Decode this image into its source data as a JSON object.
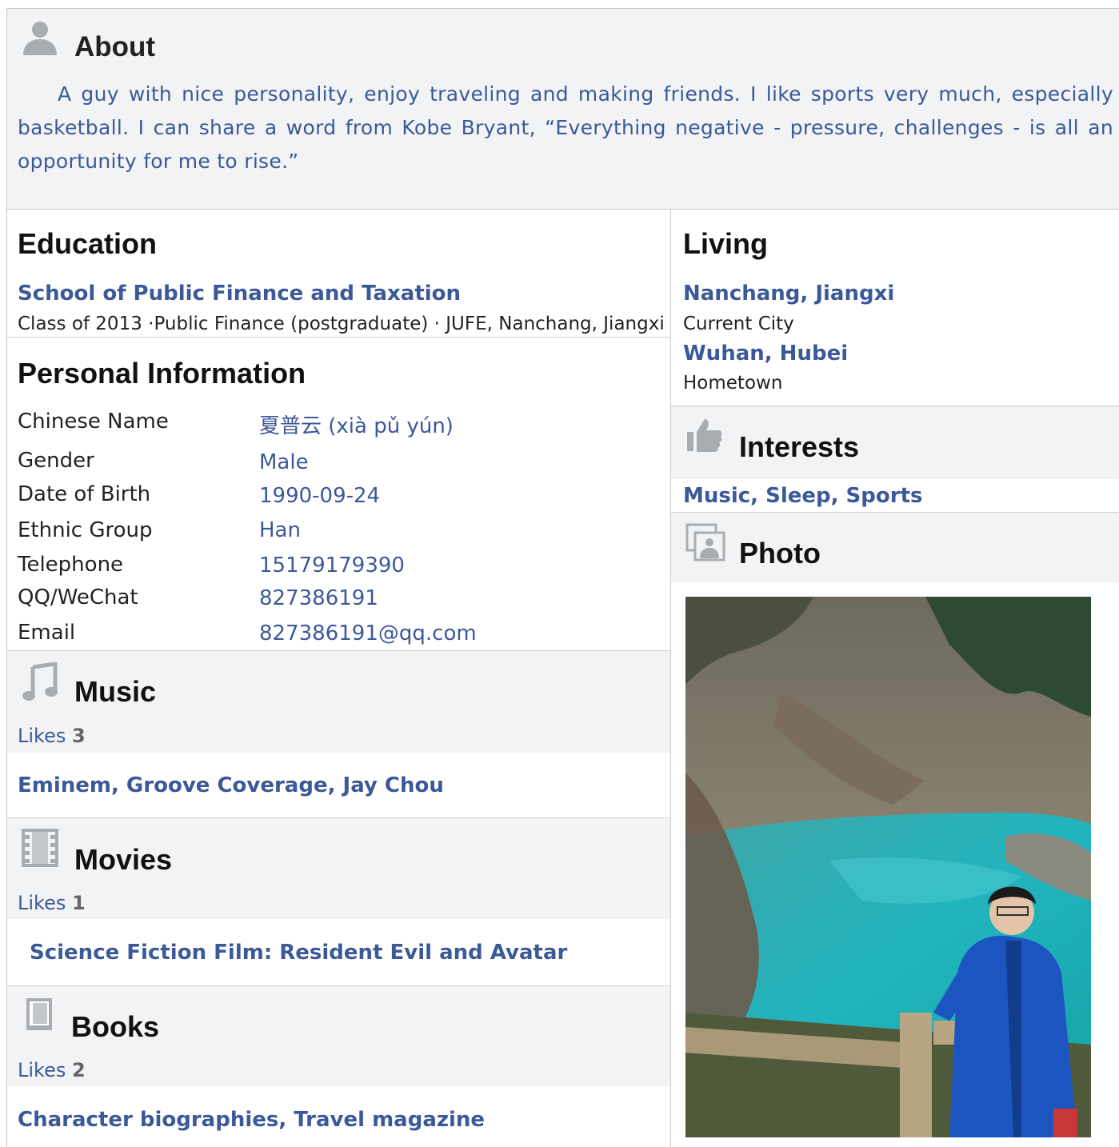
{
  "about": {
    "title": "About",
    "text": "A guy with nice personality, enjoy traveling and making friends. I like sports very much, especially basketball. I can share a word from Kobe Bryant, “Everything negative - pressure, challenges - is all an opportunity for me to rise.”",
    "icon": "person-icon"
  },
  "education": {
    "title": "Education",
    "school": "School of Public Finance and Taxation",
    "detail": "Class of 2013 ·Public Finance (postgraduate) · JUFE, Nanchang, Jiangxi"
  },
  "personal": {
    "title": "Personal Information",
    "rows": [
      {
        "label": "Chinese Name",
        "value": "夏普云  (xià pǔ yún)"
      },
      {
        "label": "Gender",
        "value": "Male"
      },
      {
        "label": "Date of Birth",
        "value": "1990-09-24"
      },
      {
        "label": "Ethnic Group",
        "value": "Han"
      },
      {
        "label": "Telephone",
        "value": "15179179390"
      },
      {
        "label": "QQ/WeChat",
        "value": "827386191"
      },
      {
        "label": "Email",
        "value": "827386191@qq.com"
      }
    ]
  },
  "music": {
    "title": "Music",
    "likes_label": "Likes",
    "likes_count": "3",
    "items": "Eminem, Groove Coverage, Jay Chou",
    "icon": "music-note-icon"
  },
  "movies": {
    "title": "Movies",
    "likes_label": "Likes",
    "likes_count": "1",
    "items": "Science Fiction Film: Resident Evil and Avatar",
    "icon": "film-strip-icon"
  },
  "books": {
    "title": "Books",
    "likes_label": "Likes",
    "likes_count": "2",
    "items": "Character biographies, Travel magazine",
    "icon": "book-icon"
  },
  "living": {
    "title": "Living",
    "current_city": "Nanchang, Jiangxi",
    "current_label": "Current City",
    "hometown": "Wuhan, Hubei",
    "hometown_label": "Hometown"
  },
  "interests": {
    "title": "Interests",
    "items": "Music, Sleep, Sports",
    "icon": "thumbs-up-icon"
  },
  "photo": {
    "title": "Photo",
    "icon": "photo-frame-icon"
  },
  "colors": {
    "link": "#3b5998",
    "band": "#f2f3f4",
    "border": "#c8c8c8"
  }
}
